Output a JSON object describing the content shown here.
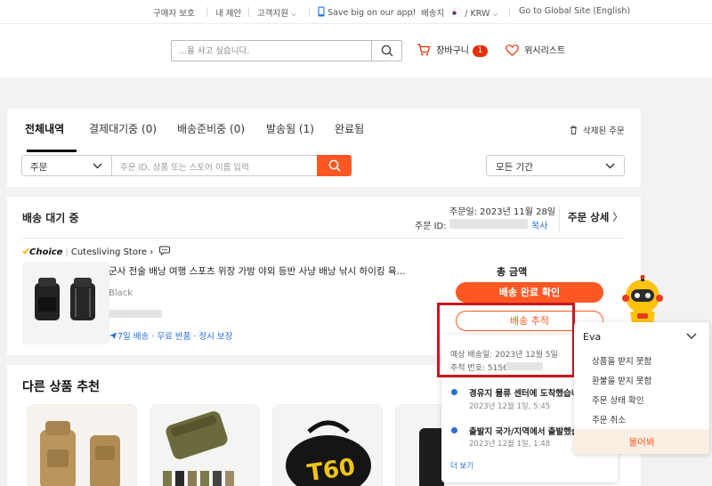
{
  "topbar": {
    "items": [
      "구매자 보호",
      "내 제안",
      "고객지원",
      "Save big on our app!",
      "배송지",
      "/ KRW",
      "Go to Global Site (English)"
    ]
  },
  "header": {
    "search_placeholder": "...을 사고 싶습니다.",
    "cart_label": "장바구니",
    "cart_count": "1",
    "wishlist_label": "위시리스트"
  },
  "orders": {
    "tabs": [
      "전체내역",
      "결제대기중 (0)",
      "배송준비중 (0)",
      "발송됨 (1)",
      "완료됨"
    ],
    "deleted_orders": "삭제된 주문",
    "filter_select": "주문",
    "filter_placeholder": "주문 ID, 상품 또는 스토어 이름 입력",
    "period_select": "모든 기간"
  },
  "order": {
    "status": "배송 대기 중",
    "date_label": "주문일: 2023년 11월 28일",
    "id_label": "주문 ID:",
    "copy": "복사",
    "detail": "주문 상세",
    "choice_badge": "Choice",
    "store_name": "Cutesliving Store",
    "product_title": "군사 전술 배낭 여행 스포츠 위장 가방 야외 등반 사냥 배낭 낚시 하이킹 육...",
    "variant": "Black",
    "perks": "7일 배송 · 무료 반품 · 정시 보장",
    "total_label": "총 금액",
    "confirm_button": "배송 완료 확인",
    "track_button": "배송 추적"
  },
  "tracking": {
    "eta": "예상 배송일: 2023년 12월 5일",
    "tracking_no": "추적 번호: 5156",
    "events": [
      {
        "text": "경유지 물류 센터에 도착했습니",
        "date": "2023년 12월 1일, 5:45"
      },
      {
        "text": "출발지 국가/지역에서 출발했습",
        "date": "2023년 12월 1일, 1:48"
      }
    ],
    "more": "더 보기"
  },
  "chat": {
    "name": "Eva",
    "options": [
      "상품을 받지 못함",
      "환불을 받지 못함",
      "주문 상태 확인",
      "주문 취소"
    ],
    "ask": "물어봐"
  },
  "recommend": {
    "title": "다른 상품 추천"
  },
  "colors": {
    "accent": "#fd5823",
    "highlight_box": "#c9161f",
    "link": "#2a6fd6",
    "badge": "#e62e04"
  }
}
